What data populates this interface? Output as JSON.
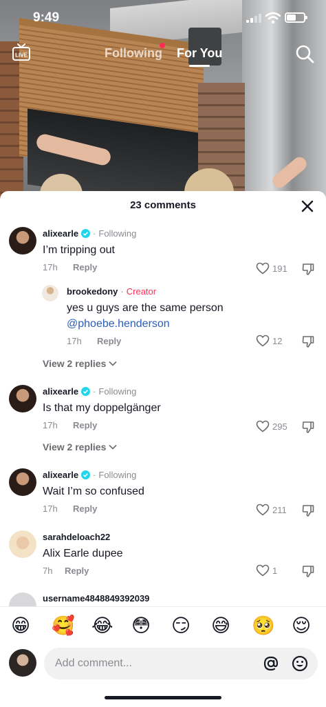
{
  "status_bar": {
    "time": "9:49",
    "battery_level": 0.55
  },
  "top_nav": {
    "live_label": "LIVE",
    "tabs": [
      {
        "label": "Following",
        "active": false,
        "has_notification_dot": true
      },
      {
        "label": "For You",
        "active": true
      }
    ]
  },
  "comments_sheet": {
    "title": "23 comments",
    "comments": [
      {
        "username": "alixearle",
        "verified": true,
        "tag": "Following",
        "text": "I’m tripping out",
        "time": "17h",
        "reply_label": "Reply",
        "likes": "191"
      },
      {
        "username": "brookedony",
        "tag": "Creator",
        "is_reply": true,
        "text": "yes u guys are the same person",
        "mention": "@phoebe.henderson",
        "time": "17h",
        "reply_label": "Reply",
        "likes": "12"
      },
      {
        "username": "alixearle",
        "verified": true,
        "tag": "Following",
        "text": "Is that my doppelgänger",
        "time": "17h",
        "reply_label": "Reply",
        "likes": "295"
      },
      {
        "username": "alixearle",
        "verified": true,
        "tag": "Following",
        "text": "Wait I’m so confused",
        "time": "17h",
        "reply_label": "Reply",
        "likes": "211"
      },
      {
        "username": "sarahdeloach22",
        "text": "Alix Earle dupee",
        "time": "7h",
        "reply_label": "Reply",
        "likes": "1"
      },
      {
        "username": "username4848849392039"
      }
    ],
    "view_replies": [
      "View 2 replies",
      "View 2 replies"
    ]
  },
  "emoji_bar": [
    "😁",
    "🥰",
    "😂",
    "😳",
    "😏",
    "😅",
    "🥺",
    "😌"
  ],
  "comment_input": {
    "placeholder": "Add comment...",
    "value": ""
  },
  "colors": {
    "accent_red": "#fe2c55",
    "verified_blue": "#20d5ec",
    "mention_blue": "#2b5db9",
    "meta_gray": "#8a8b91"
  },
  "icons": [
    "live-icon",
    "search-icon",
    "close-icon",
    "verified-icon",
    "heart-icon",
    "dislike-icon",
    "chevron-down-icon",
    "at-icon",
    "emoji-icon"
  ]
}
